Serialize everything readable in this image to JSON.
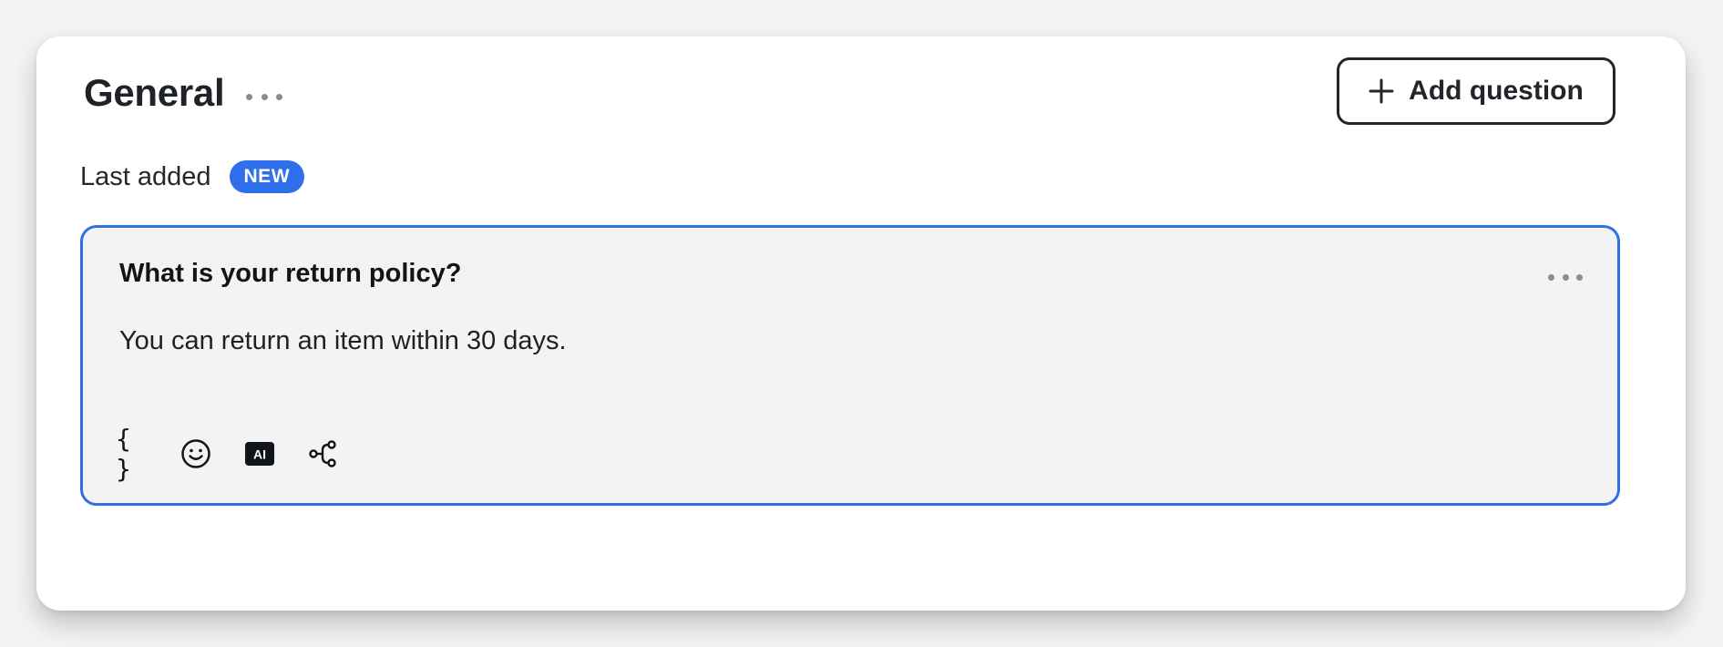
{
  "section": {
    "title": "General",
    "more_icon": "more-horizontal-icon"
  },
  "actions": {
    "add_question_label": "Add question",
    "add_icon": "plus-icon"
  },
  "last_added": {
    "label": "Last added",
    "badge": "NEW"
  },
  "qa_item": {
    "question": "What is your return policy?",
    "answer": "You can return an item within 30 days.",
    "more_icon": "more-horizontal-icon",
    "toolbar": [
      {
        "name": "variables-braces-icon",
        "text": "{ }"
      },
      {
        "name": "emoji-icon"
      },
      {
        "name": "ai-icon",
        "text": "AI"
      },
      {
        "name": "workflow-branch-icon"
      }
    ]
  },
  "colors": {
    "accent": "#2f6fec",
    "card_bg": "#ffffff",
    "qa_bg": "#f3f3f3",
    "text": "#1f2328"
  }
}
